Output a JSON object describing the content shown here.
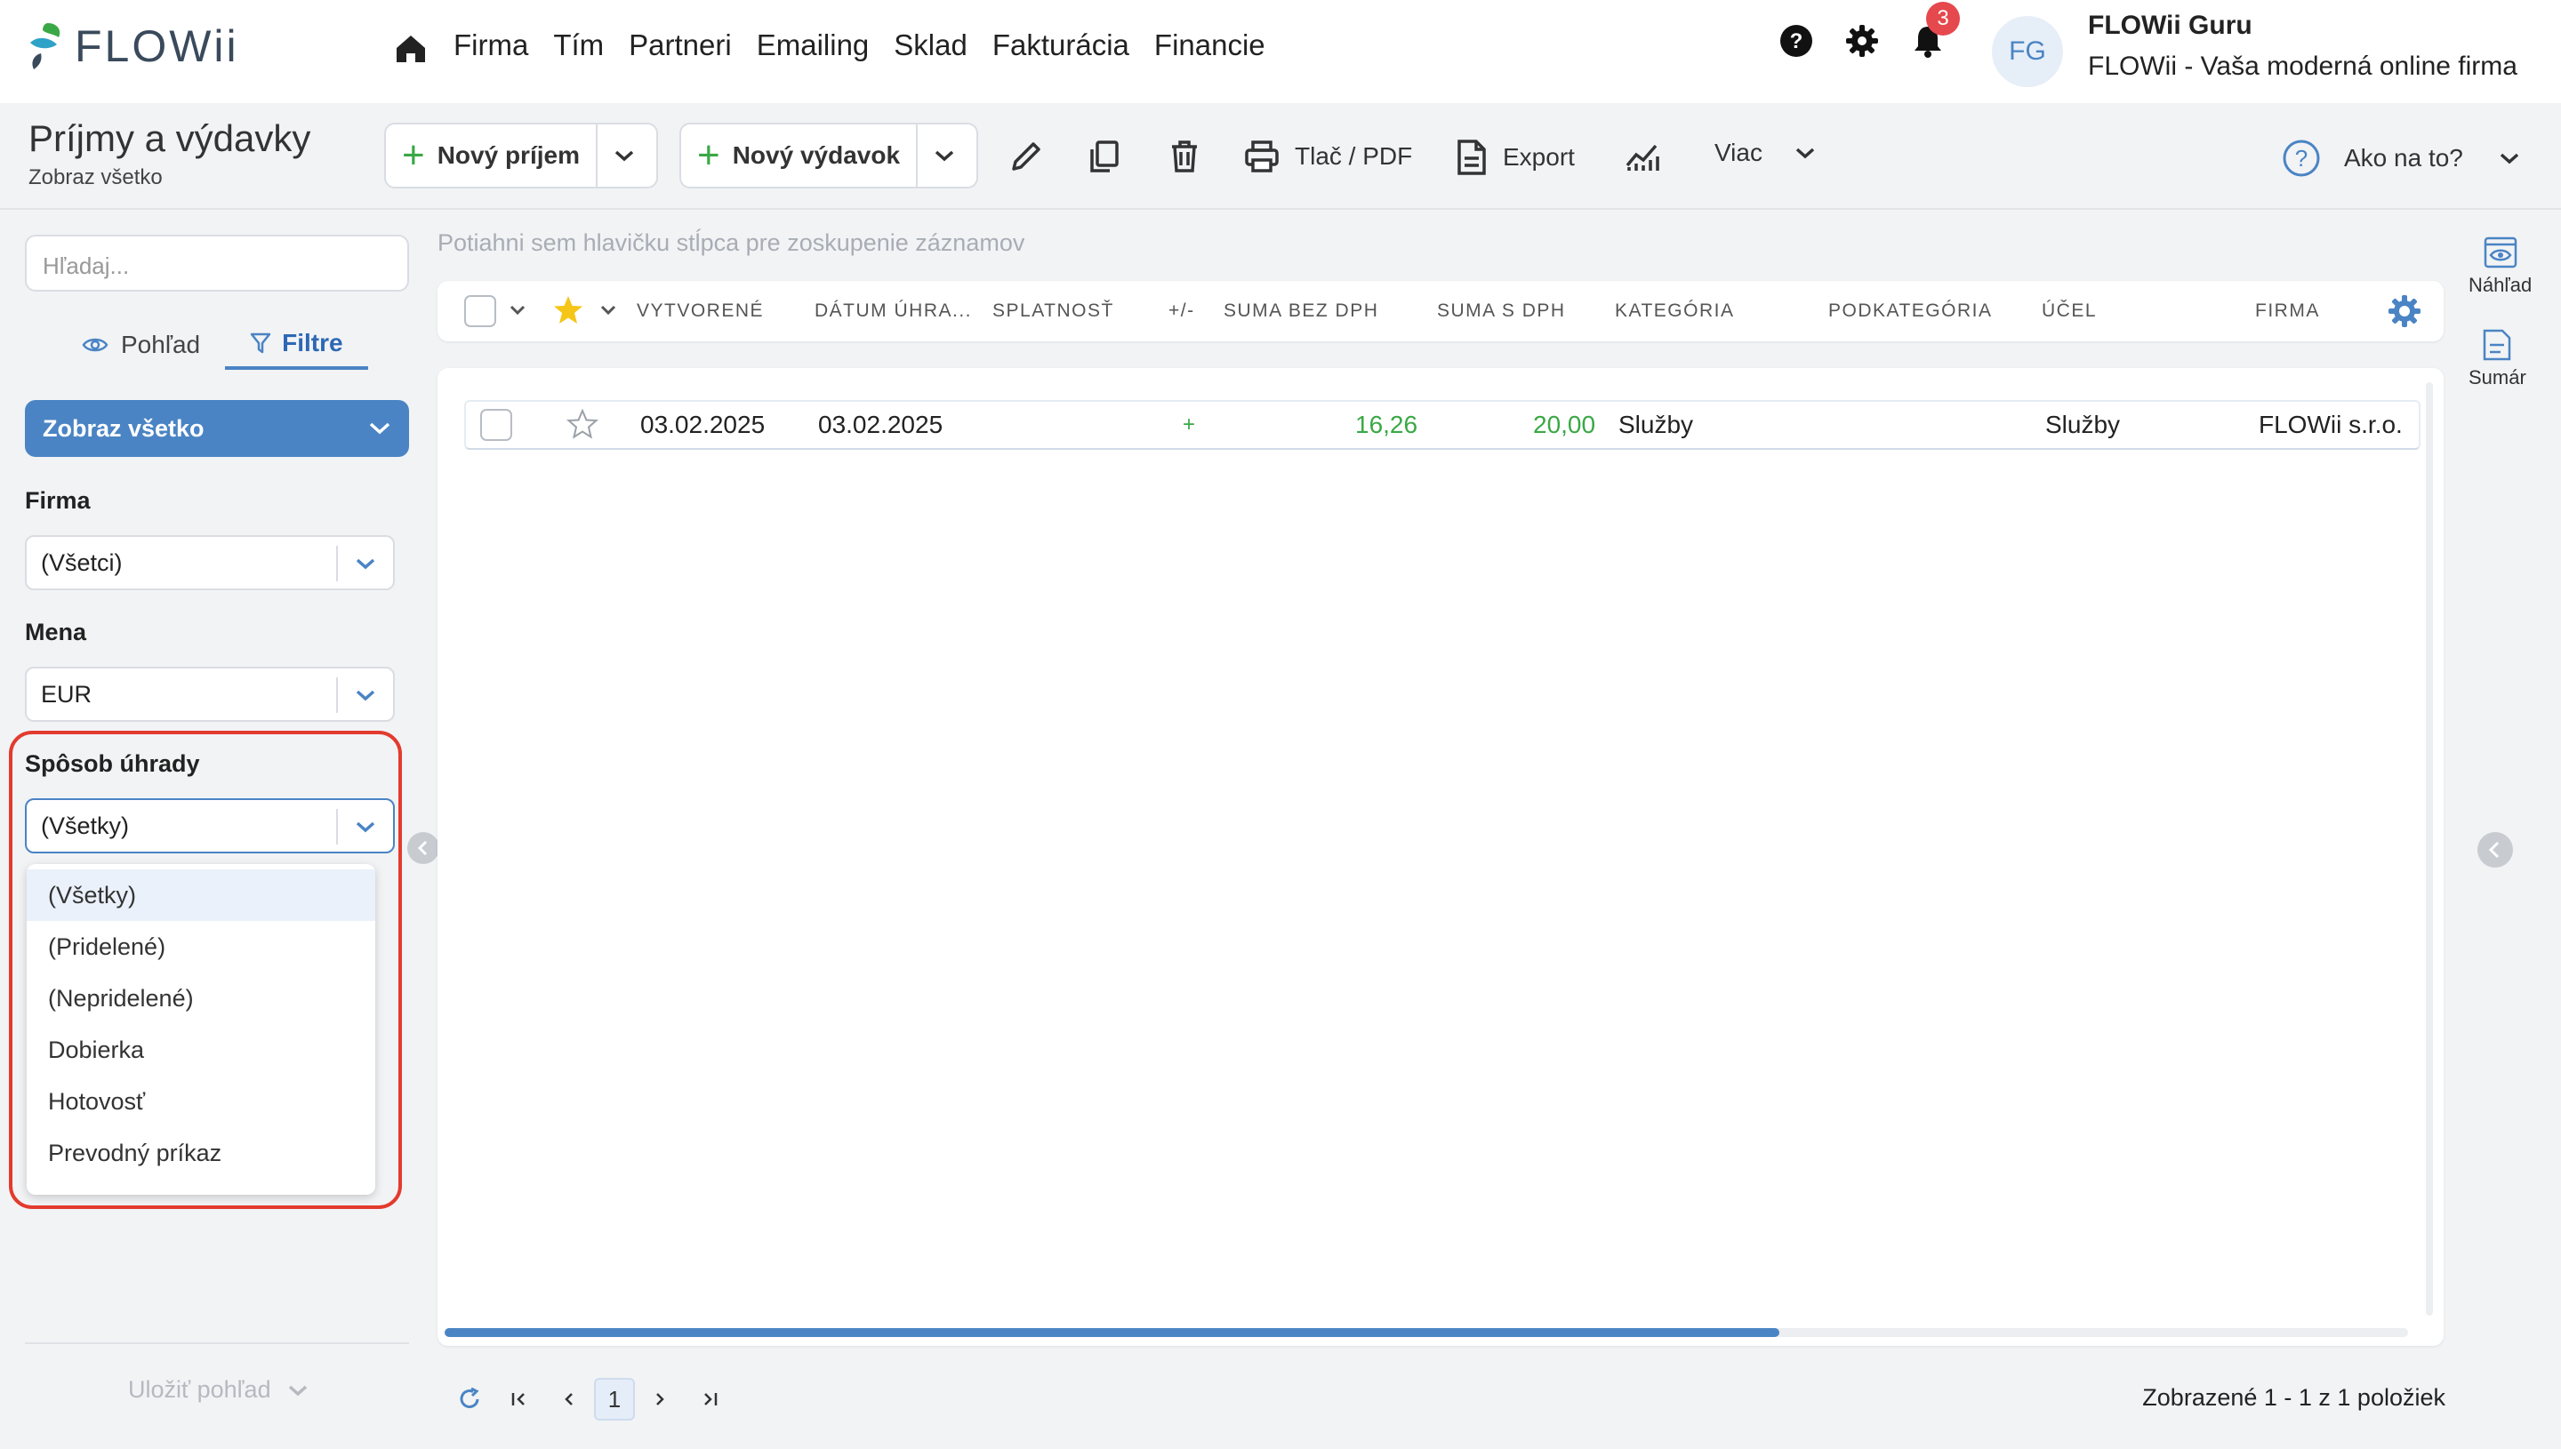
{
  "app": {
    "logo_text": "FLOWii"
  },
  "nav": {
    "items": [
      "Firma",
      "Tím",
      "Partneri",
      "Emailing",
      "Sklad",
      "Fakturácia",
      "Financie"
    ]
  },
  "header": {
    "notification_count": "3",
    "avatar_initials": "FG",
    "user_name": "FLOWii Guru",
    "user_subtitle": "FLOWii - Vaša moderná online firma"
  },
  "toolbar": {
    "title": "Príjmy a výdavky",
    "subtitle": "Zobraz všetko",
    "new_income": "Nový príjem",
    "new_expense": "Nový výdavok",
    "print_pdf": "Tlač / PDF",
    "export": "Export",
    "more": "Viac",
    "help": "Ako na to?"
  },
  "sidebar": {
    "search_placeholder": "Hľadaj...",
    "tab_view": "Pohľad",
    "tab_filters": "Filtre",
    "show_all": "Zobraz všetko",
    "company_label": "Firma",
    "company_value": "(Všetci)",
    "currency_label": "Mena",
    "currency_value": "EUR",
    "payment_label": "Spôsob úhrady",
    "payment_value": "(Všetky)",
    "payment_options": [
      "(Všetky)",
      "(Pridelené)",
      "(Nepridelené)",
      "Dobierka",
      "Hotovosť",
      "Prevodný príkaz"
    ],
    "save_view": "Uložiť pohľad"
  },
  "grid": {
    "group_hint": "Potiahni sem hlavičku stĺpca pre zoskupenie záznamov",
    "columns": [
      "VYTVORENÉ",
      "DÁTUM ÚHRA...",
      "SPLATNOSŤ",
      "+/-",
      "SUMA BEZ DPH",
      "SUMA S DPH",
      "KATEGÓRIA",
      "PODKATEGÓRIA",
      "ÚČEL",
      "FIRMA"
    ],
    "rows": [
      {
        "created": "03.02.2025",
        "paid": "03.02.2025",
        "due": "",
        "sign": "+",
        "net": "16,26",
        "gross": "20,00",
        "category": "Služby",
        "subcategory": "",
        "purpose": "Služby",
        "company": "FLOWii s.r.o."
      }
    ],
    "scroll_fraction": 0.68
  },
  "right_panel": {
    "preview": "Náhľad",
    "summary": "Sumár"
  },
  "pager": {
    "current_page": "1",
    "info": "Zobrazené 1 - 1 z 1 položiek"
  },
  "colors": {
    "accent": "#4a84c4",
    "positive": "#3aa845",
    "highlight": "#e23b2e",
    "badge": "#e5484d"
  }
}
